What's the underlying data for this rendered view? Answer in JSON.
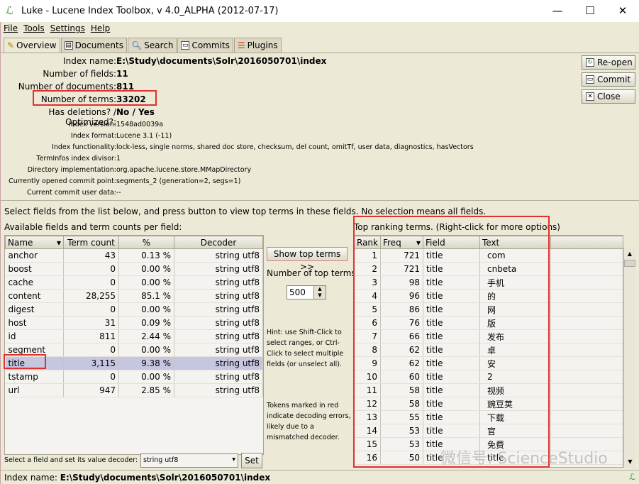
{
  "window": {
    "title": "Luke - Lucene Index Toolbox, v 4.0_ALPHA (2012-07-17)",
    "min": "—",
    "max": "☐",
    "close": "✕"
  },
  "menu": [
    "File",
    "Tools",
    "Settings",
    "Help"
  ],
  "tabs": [
    {
      "label": "Overview",
      "icon": "wand-icon"
    },
    {
      "label": "Documents",
      "icon": "documents-icon"
    },
    {
      "label": "Search",
      "icon": "search-icon"
    },
    {
      "label": "Commits",
      "icon": "floppy-icon"
    },
    {
      "label": "Plugins",
      "icon": "plugins-icon"
    }
  ],
  "overview": {
    "main": [
      {
        "k": "Index name:",
        "v": "E:\\Study\\documents\\Solr\\2016050701\\index"
      },
      {
        "k": "Number of fields:",
        "v": "11"
      },
      {
        "k": "Number of documents:",
        "v": "811"
      },
      {
        "k": "Number of terms:",
        "v": "33202"
      },
      {
        "k": "Has deletions? / Optimized?:",
        "v": "No / Yes"
      }
    ],
    "details": [
      {
        "k": "Index version:",
        "v": "1548ad0039a"
      },
      {
        "k": "Index format:",
        "v": "Lucene 3.1 (-11)"
      },
      {
        "k": "Index functionality:",
        "v": "lock-less, single norms, shared doc store, checksum, del count, omitTf, user data, diagnostics, hasVectors"
      },
      {
        "k": "TermInfos index divisor:",
        "v": "1"
      },
      {
        "k": "Directory implementation:",
        "v": "org.apache.lucene.store.MMapDirectory"
      },
      {
        "k": "Currently opened commit point:",
        "v": "segments_2 (generation=2, segs=1)"
      },
      {
        "k": "Current commit user data:",
        "v": "--"
      }
    ]
  },
  "buttons": {
    "reopen": "Re-open",
    "commit": "Commit",
    "close": "Close"
  },
  "instructions": "Select fields from the list below, and press button to view top terms in these fields. No selection means all fields.",
  "fields": {
    "caption": "Available fields and term counts per field:",
    "headers": [
      "Name",
      "Term count",
      "%",
      "Decoder"
    ],
    "rows": [
      [
        "anchor",
        "43",
        "0.13 %",
        "string utf8"
      ],
      [
        "boost",
        "0",
        "0.00 %",
        "string utf8"
      ],
      [
        "cache",
        "0",
        "0.00 %",
        "string utf8"
      ],
      [
        "content",
        "28,255",
        "85.1 %",
        "string utf8"
      ],
      [
        "digest",
        "0",
        "0.00 %",
        "string utf8"
      ],
      [
        "host",
        "31",
        "0.09 %",
        "string utf8"
      ],
      [
        "id",
        "811",
        "2.44 %",
        "string utf8"
      ],
      [
        "segment",
        "0",
        "0.00 %",
        "string utf8"
      ],
      [
        "title",
        "3,115",
        "9.38 %",
        "string utf8"
      ],
      [
        "tstamp",
        "0",
        "0.00 %",
        "string utf8"
      ],
      [
        "url",
        "947",
        "2.85 %",
        "string utf8"
      ]
    ],
    "selected": "title",
    "decoder_label": "Select a field and set its value decoder:",
    "decoder_value": "string utf8",
    "set": "Set"
  },
  "middle": {
    "show": "Show top terms >>",
    "num_label": "Number of top terms:",
    "num_value": "500",
    "hint": "Hint: use Shift-Click to select ranges, or Ctrl-Click to select multiple fields (or unselect all).",
    "tokens": "Tokens marked in red indicate decoding errors, likely due to a mismatched decoder."
  },
  "top": {
    "caption": "Top ranking terms. (Right-click for more options)",
    "headers": [
      "Rank",
      "Freq",
      "Field",
      "Text"
    ],
    "rows": [
      [
        "1",
        "721",
        "title",
        "com"
      ],
      [
        "2",
        "721",
        "title",
        "cnbeta"
      ],
      [
        "3",
        "98",
        "title",
        "手机"
      ],
      [
        "4",
        "96",
        "title",
        "的"
      ],
      [
        "5",
        "86",
        "title",
        "网"
      ],
      [
        "6",
        "76",
        "title",
        "版"
      ],
      [
        "7",
        "66",
        "title",
        "发布"
      ],
      [
        "8",
        "62",
        "title",
        "卓"
      ],
      [
        "9",
        "62",
        "title",
        "安"
      ],
      [
        "10",
        "60",
        "title",
        "2"
      ],
      [
        "11",
        "58",
        "title",
        "视频"
      ],
      [
        "12",
        "58",
        "title",
        "豌豆荚"
      ],
      [
        "13",
        "55",
        "title",
        "下载"
      ],
      [
        "14",
        "53",
        "title",
        "官"
      ],
      [
        "15",
        "53",
        "title",
        "免费"
      ],
      [
        "16",
        "50",
        "title",
        "title"
      ]
    ]
  },
  "status": {
    "label": "Index name:",
    "value": "E:\\Study\\documents\\Solr\\2016050701\\index"
  },
  "watermark": "微信号: ScienceStudio",
  "highlight_color": "#e03030"
}
